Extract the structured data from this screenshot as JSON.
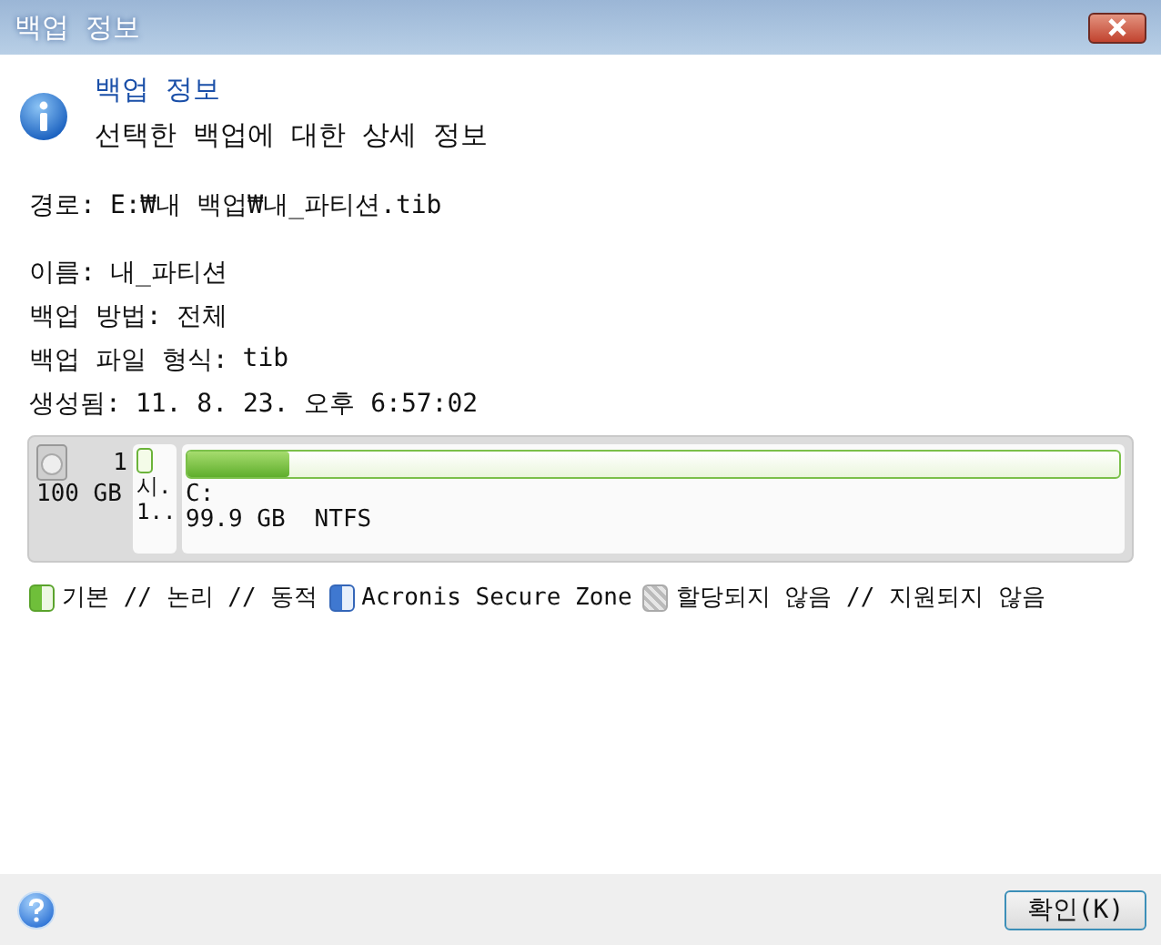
{
  "window": {
    "title": "백업 정보"
  },
  "header": {
    "title": "백업 정보",
    "subtitle": "선택한 백업에 대한 상세 정보"
  },
  "path": {
    "label": "경로:",
    "value": "E:₩내 백업₩내_파티션.tib"
  },
  "details": [
    {
      "label": "이름:",
      "value": "내_파티션"
    },
    {
      "label": "백업 방법:",
      "value": "전체"
    },
    {
      "label": "백업 파일 형식:",
      "value": "tib"
    },
    {
      "label": "생성됨:",
      "value": "11. 8. 23. 오후 6:57:02"
    }
  ],
  "disk": {
    "number": "1",
    "size": "100 GB",
    "partition_label": "시.",
    "partition_size": "1..",
    "volume": "C:",
    "volume_size": "99.9 GB",
    "filesystem": "NTFS",
    "level": 0.11
  },
  "legend": [
    {
      "kind": "basic",
      "label": "기본 // 논리 // 동적"
    },
    {
      "kind": "secure",
      "label": "Acronis Secure Zone"
    },
    {
      "kind": "unallocated",
      "label": "할당되지 않음 // 지원되지 않음"
    }
  ],
  "buttons": [
    {
      "label": "확인(K)"
    }
  ]
}
